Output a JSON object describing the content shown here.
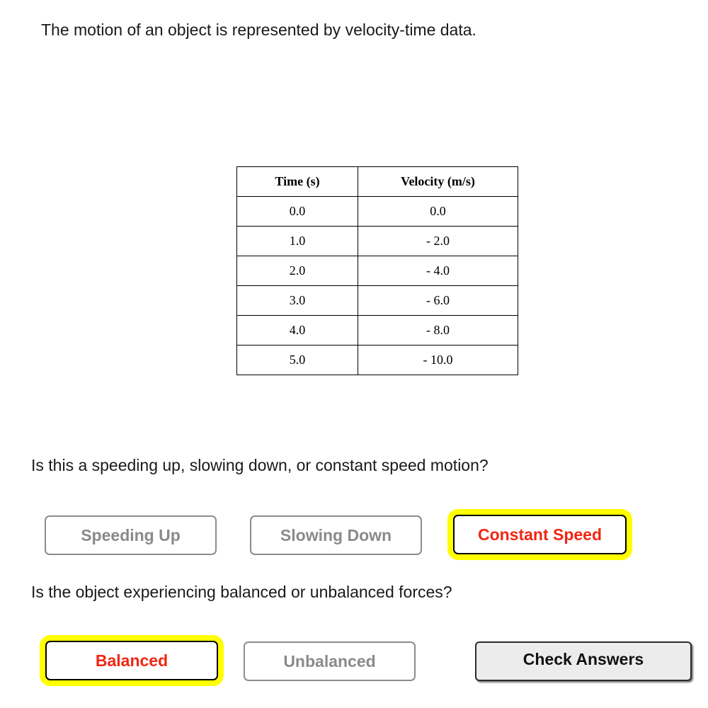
{
  "intro_text": "The motion of an object is represented by velocity-time data.",
  "table": {
    "headers": [
      "Time (s)",
      "Velocity (m/s)"
    ],
    "rows": [
      [
        "0.0",
        "0.0"
      ],
      [
        "1.0",
        "- 2.0"
      ],
      [
        "2.0",
        "- 4.0"
      ],
      [
        "3.0",
        "- 6.0"
      ],
      [
        "4.0",
        "- 8.0"
      ],
      [
        "5.0",
        "- 10.0"
      ]
    ]
  },
  "question1": {
    "text": "Is this a speeding up, slowing down, or constant speed motion?",
    "options": [
      "Speeding Up",
      "Slowing Down",
      "Constant Speed"
    ],
    "selected": "Constant Speed"
  },
  "question2": {
    "text": "Is the object experiencing balanced or unbalanced forces?",
    "options": [
      "Balanced",
      "Unbalanced"
    ],
    "selected": "Balanced"
  },
  "check_button_label": "Check Answers",
  "colors": {
    "selected_text": "#f22613",
    "selected_highlight": "#ffff00",
    "unselected_text": "#8a8a8a",
    "check_button_bg": "#ececec"
  }
}
